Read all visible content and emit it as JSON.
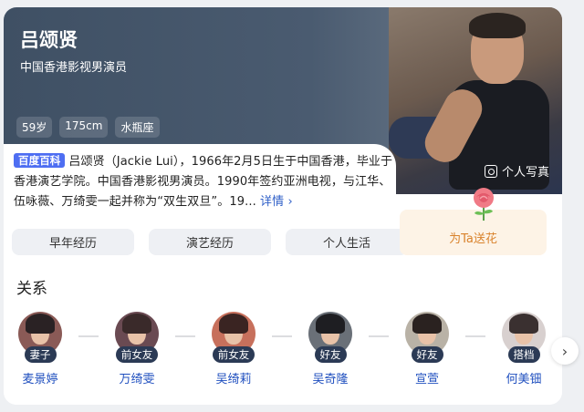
{
  "header": {
    "name": "吕颂贤",
    "subtitle": "中国香港影视男演员",
    "tags": [
      "59岁",
      "175cm",
      "水瓶座"
    ],
    "photos_label": "个人写真"
  },
  "intro": {
    "source_badge": "百度百科",
    "text": "吕颂贤（Jackie Lui），1966年2月5日生于中国香港，毕业于香港演艺学院。中国香港影视男演员。1990年签约亚洲电视，与江华、伍咏薇、万绮雯一起并称为“双生双旦”。19...",
    "more_label": "详情 ›"
  },
  "sections": [
    "早年经历",
    "演艺经历",
    "个人生活"
  ],
  "flower_label": "为Ta送花",
  "relations": {
    "title": "关系",
    "items": [
      {
        "relation": "妻子",
        "name": "麦景婷",
        "bg": "#8a5a56"
      },
      {
        "relation": "前女友",
        "name": "万绮雯",
        "bg": "#6a4a52"
      },
      {
        "relation": "前女友",
        "name": "吴绮莉",
        "bg": "#c7705c"
      },
      {
        "relation": "好友",
        "name": "吴奇隆",
        "bg": "#6a7078"
      },
      {
        "relation": "好友",
        "name": "宣萱",
        "bg": "#b9b2a6"
      },
      {
        "relation": "搭档",
        "name": "何美钿",
        "bg": "#d8d0cf"
      }
    ]
  },
  "colors": {
    "hero_bg": "#4a5b70",
    "badge_blue": "#4e6ef2",
    "link_blue": "#1f4fbf",
    "flower_orange": "#d9822b"
  }
}
